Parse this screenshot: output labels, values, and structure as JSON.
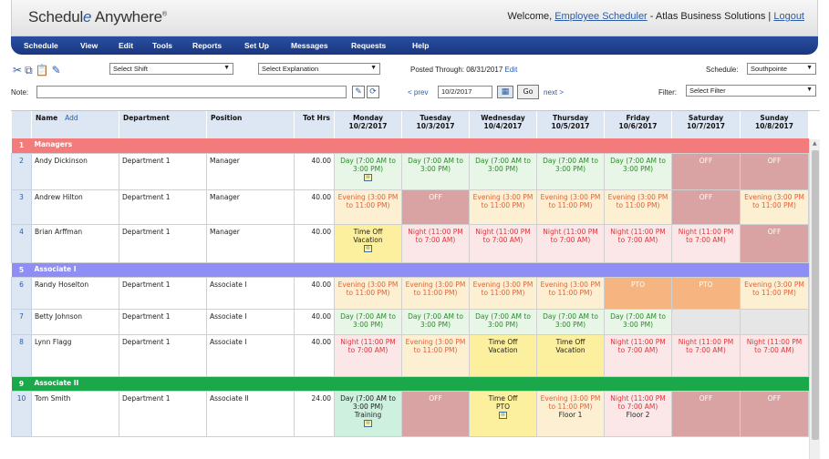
{
  "header": {
    "logo_left": "Schedul",
    "logo_e": "e",
    "logo_right": " Anywhere",
    "logo_mark": "®",
    "welcome_prefix": "Welcome,",
    "user": "Employee Scheduler",
    "org": "- Atlas Business Solutions |",
    "logout": "Logout"
  },
  "menu": [
    "Schedule",
    "View",
    "Edit",
    "Tools",
    "Reports",
    "Set Up",
    "Messages",
    "Requests",
    "Help"
  ],
  "toolbar": {
    "select_shift": "Select Shift",
    "select_explanation": "Select Explanation",
    "posted_label": "Posted Through: 08/31/2017",
    "posted_edit": "Edit",
    "schedule_label": "Schedule:",
    "schedule_value": "Southpointe",
    "note_label": "Note:",
    "prev": "< prev",
    "date_value": "10/2/2017",
    "go": "Go",
    "next": "next >",
    "filter_label": "Filter:",
    "filter_value": "Select Filter"
  },
  "columns": {
    "name": "Name",
    "add": "Add",
    "department": "Department",
    "position": "Position",
    "tot_hrs": "Tot Hrs",
    "days": [
      {
        "day": "Monday",
        "date": "10/2/2017"
      },
      {
        "day": "Tuesday",
        "date": "10/3/2017"
      },
      {
        "day": "Wednesday",
        "date": "10/4/2017"
      },
      {
        "day": "Thursday",
        "date": "10/5/2017"
      },
      {
        "day": "Friday",
        "date": "10/6/2017"
      },
      {
        "day": "Saturday",
        "date": "10/7/2017"
      },
      {
        "day": "Sunday",
        "date": "10/8/2017"
      }
    ]
  },
  "colors": {
    "managers": "#f47b7b",
    "associate_i": "#8e8ef5",
    "associate_ii": "#1aa84a"
  },
  "rows": [
    {
      "kind": "section",
      "idx": "1",
      "label": "Managers",
      "color": "#f47b7b"
    },
    {
      "kind": "emp",
      "idx": "2",
      "name": "Andy Dickinson",
      "dept": "Department 1",
      "pos": "Manager",
      "hrs": "40.00",
      "cells": [
        {
          "t": "day",
          "text": "Day (7:00 AM to 3:00 PM)",
          "note": true
        },
        {
          "t": "day",
          "text": "Day (7:00 AM to 3:00 PM)"
        },
        {
          "t": "day",
          "text": "Day (7:00 AM to 3:00 PM)"
        },
        {
          "t": "day",
          "text": "Day (7:00 AM to 3:00 PM)"
        },
        {
          "t": "day",
          "text": "Day (7:00 AM to 3:00 PM)"
        },
        {
          "t": "off",
          "text": "OFF"
        },
        {
          "t": "off",
          "text": "OFF"
        }
      ]
    },
    {
      "kind": "emp",
      "idx": "3",
      "name": "Andrew Hilton",
      "dept": "Department 1",
      "pos": "Manager",
      "hrs": "40.00",
      "cells": [
        {
          "t": "eve",
          "text": "Evening (3:00 PM to 11:00 PM)"
        },
        {
          "t": "off",
          "text": "OFF"
        },
        {
          "t": "eve",
          "text": "Evening (3:00 PM to 11:00 PM)"
        },
        {
          "t": "eve",
          "text": "Evening (3:00 PM to 11:00 PM)"
        },
        {
          "t": "eve",
          "text": "Evening (3:00 PM to 11:00 PM)"
        },
        {
          "t": "off",
          "text": "OFF"
        },
        {
          "t": "eve",
          "text": "Evening (3:00 PM to 11:00 PM)"
        }
      ]
    },
    {
      "kind": "emp",
      "idx": "4",
      "name": "Brian Arffman",
      "dept": "Department 1",
      "pos": "Manager",
      "hrs": "40.00",
      "cells": [
        {
          "t": "to",
          "text": "Time Off",
          "sub": "Vacation",
          "note": true
        },
        {
          "t": "night",
          "text": "Night (11:00 PM to 7:00 AM)"
        },
        {
          "t": "night",
          "text": "Night (11:00 PM to 7:00 AM)"
        },
        {
          "t": "night",
          "text": "Night (11:00 PM to 7:00 AM)"
        },
        {
          "t": "night",
          "text": "Night (11:00 PM to 7:00 AM)"
        },
        {
          "t": "night",
          "text": "Night (11:00 PM to 7:00 AM)"
        },
        {
          "t": "off",
          "text": "OFF"
        }
      ]
    },
    {
      "kind": "section",
      "idx": "5",
      "label": "Associate I",
      "color": "#8e8ef5"
    },
    {
      "kind": "emp",
      "idx": "6",
      "name": "Randy Hoselton",
      "dept": "Department 1",
      "pos": "Associate I",
      "hrs": "40.00",
      "cells": [
        {
          "t": "eve",
          "text": "Evening (3:00 PM to 11:00 PM)"
        },
        {
          "t": "eve",
          "text": "Evening (3:00 PM to 11:00 PM)"
        },
        {
          "t": "eve",
          "text": "Evening (3:00 PM to 11:00 PM)"
        },
        {
          "t": "eve",
          "text": "Evening (3:00 PM to 11:00 PM)"
        },
        {
          "t": "pto",
          "text": "PTO"
        },
        {
          "t": "pto",
          "text": "PTO"
        },
        {
          "t": "eve",
          "text": "Evening (3:00 PM to 11:00 PM)"
        }
      ]
    },
    {
      "kind": "emp",
      "idx": "7",
      "name": "Betty Johnson",
      "dept": "Department 1",
      "pos": "Associate I",
      "hrs": "40.00",
      "cells": [
        {
          "t": "day",
          "text": "Day (7:00 AM to 3:00 PM)"
        },
        {
          "t": "day",
          "text": "Day (7:00 AM to 3:00 PM)"
        },
        {
          "t": "day",
          "text": "Day (7:00 AM to 3:00 PM)"
        },
        {
          "t": "day",
          "text": "Day (7:00 AM to 3:00 PM)"
        },
        {
          "t": "day",
          "text": "Day (7:00 AM to 3:00 PM)"
        },
        {
          "t": "empty",
          "text": ""
        },
        {
          "t": "empty",
          "text": ""
        }
      ]
    },
    {
      "kind": "emp",
      "idx": "8",
      "name": "Lynn Flagg",
      "dept": "Department 1",
      "pos": "Associate I",
      "hrs": "40.00",
      "cells": [
        {
          "t": "night",
          "text": "Night (11:00 PM to 7:00 AM)"
        },
        {
          "t": "eve",
          "text": "Evening (3:00 PM to 11:00 PM)"
        },
        {
          "t": "to",
          "text": "Time Off",
          "sub": "Vacation"
        },
        {
          "t": "to",
          "text": "Time Off",
          "sub": "Vacation"
        },
        {
          "t": "night",
          "text": "Night (11:00 PM to 7:00 AM)"
        },
        {
          "t": "night",
          "text": "Night (11:00 PM to 7:00 AM)"
        },
        {
          "t": "night",
          "text": "Night (11:00 PM to 7:00 AM)"
        }
      ]
    },
    {
      "kind": "section",
      "idx": "9",
      "label": "Associate II",
      "color": "#1aa84a"
    },
    {
      "kind": "emp",
      "idx": "10",
      "name": "Tom Smith",
      "dept": "Department 1",
      "pos": "Associate II",
      "hrs": "24.00",
      "cells": [
        {
          "t": "train",
          "text": "Day (7:00 AM to 3:00 PM)",
          "sub": "Training",
          "note": true
        },
        {
          "t": "off",
          "text": "OFF"
        },
        {
          "t": "to",
          "text": "Time Off",
          "sub": "PTO",
          "note": true
        },
        {
          "t": "eve",
          "text": "Evening (3:00 PM to 11:00 PM)",
          "sub": "Floor 1"
        },
        {
          "t": "night",
          "text": "Night (11:00 PM to 7:00 AM)",
          "sub": "Floor 2"
        },
        {
          "t": "off",
          "text": "OFF"
        },
        {
          "t": "off",
          "text": "OFF"
        }
      ]
    }
  ]
}
